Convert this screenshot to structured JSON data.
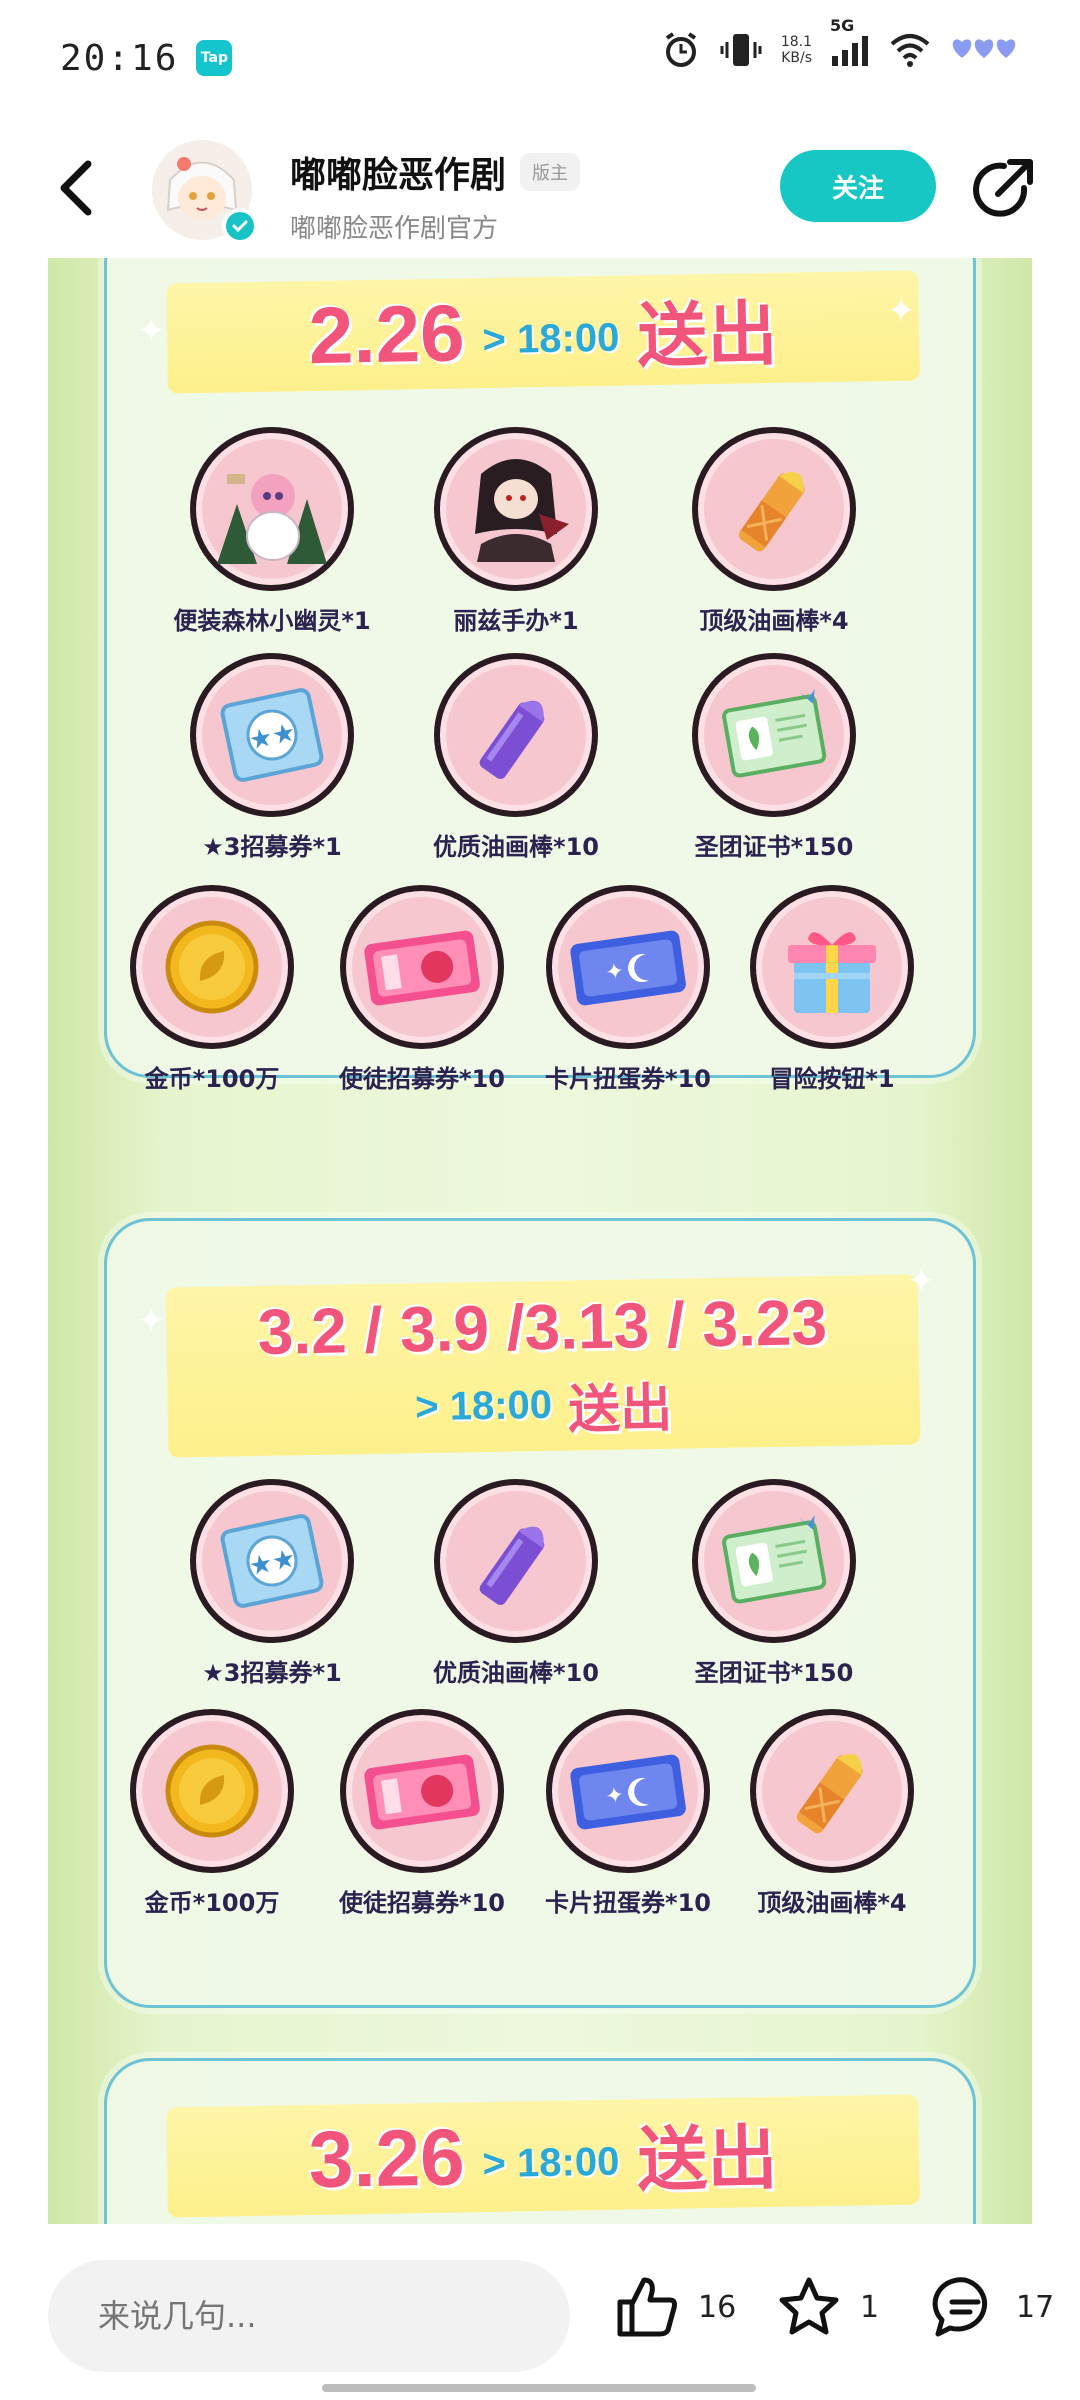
{
  "status_bar": {
    "time": "20:16",
    "app_badge": "Tap",
    "net_speed_value": "18.1",
    "net_speed_unit": "KB/s",
    "network": "5G"
  },
  "header": {
    "author_name": "嘟嘟脸恶作剧",
    "author_tag": "版主",
    "author_subtitle": "嘟嘟脸恶作剧官方",
    "follow_label": "关注"
  },
  "section_1": {
    "date": "2.26",
    "time": "> 18:00",
    "send": "送出",
    "items": [
      {
        "label": "便装森林小幽灵*1",
        "icon": "figure-ghost-icon"
      },
      {
        "label": "丽兹手办*1",
        "icon": "figure-liz-icon"
      },
      {
        "label": "顶级油画棒*4",
        "icon": "gold-crayon-icon"
      },
      {
        "label": "★3招募券*1",
        "icon": "star-ticket-icon"
      },
      {
        "label": "优质油画棒*10",
        "icon": "purple-crayon-icon"
      },
      {
        "label": "圣团证书*150",
        "icon": "certificate-icon"
      },
      {
        "label": "金币*100万",
        "icon": "gold-coin-icon"
      },
      {
        "label": "使徒招募券*10",
        "icon": "pink-ticket-icon"
      },
      {
        "label": "卡片扭蛋券*10",
        "icon": "blue-ticket-icon"
      },
      {
        "label": "冒险按钮*1",
        "icon": "gift-box-icon"
      }
    ]
  },
  "section_2": {
    "dates": "3.2 / 3.9 /3.13 / 3.23",
    "time": "> 18:00",
    "send": "送出",
    "items": [
      {
        "label": "★3招募券*1",
        "icon": "star-ticket-icon"
      },
      {
        "label": "优质油画棒*10",
        "icon": "purple-crayon-icon"
      },
      {
        "label": "圣团证书*150",
        "icon": "certificate-icon"
      },
      {
        "label": "金币*100万",
        "icon": "gold-coin-icon"
      },
      {
        "label": "使徒招募券*10",
        "icon": "pink-ticket-icon"
      },
      {
        "label": "卡片扭蛋券*10",
        "icon": "blue-ticket-icon"
      },
      {
        "label": "顶级油画棒*4",
        "icon": "gold-crayon-icon"
      }
    ]
  },
  "section_3": {
    "date": "3.26",
    "time": "> 18:00",
    "send": "送出"
  },
  "bottom_bar": {
    "comment_placeholder": "来说几句...",
    "like_count": "16",
    "favorite_count": "1",
    "comment_count": "17"
  },
  "colors": {
    "accent": "#17c7c3",
    "date_pink": "#f2557c",
    "time_blue": "#2aa8d8",
    "panel_border": "#6cc3d6",
    "item_circle": "#f7c7cf"
  }
}
